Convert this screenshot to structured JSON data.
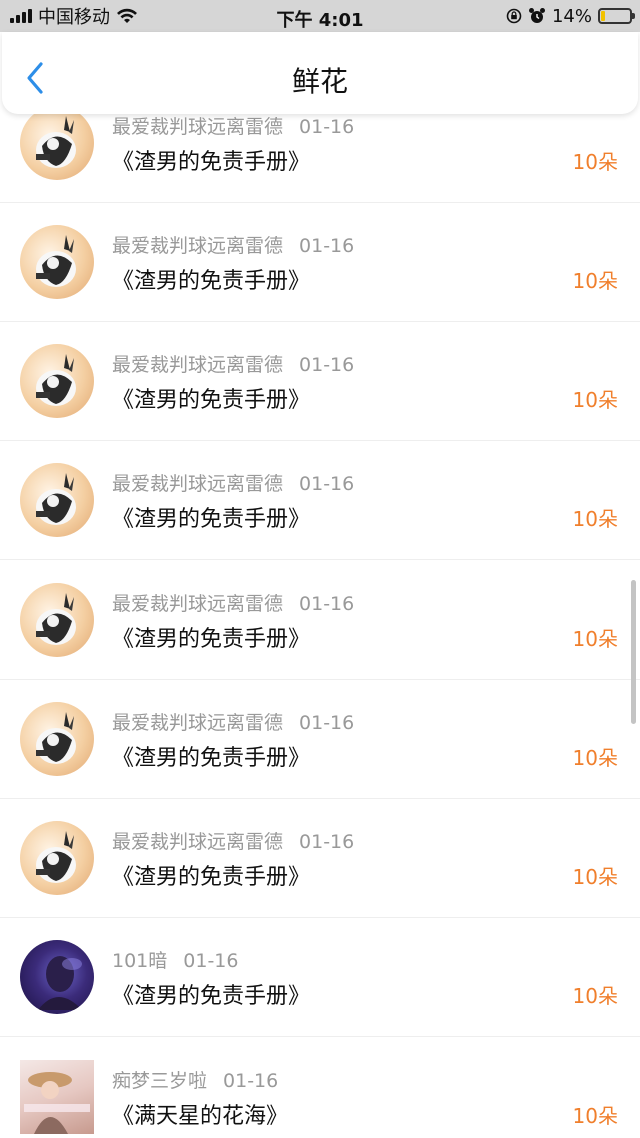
{
  "status_bar": {
    "carrier": "中国移动",
    "time": "下午 4:01",
    "battery": "14%",
    "battery_level": 0.14,
    "icons": [
      "signal-icon",
      "wifi-icon",
      "lock-rotation-icon",
      "alarm-icon",
      "battery-icon"
    ]
  },
  "nav": {
    "title": "鲜花",
    "back_icon": "chevron-left-icon"
  },
  "colors": {
    "accent": "#f07f2c",
    "back": "#2d8ee8",
    "meta": "#999999"
  },
  "items": [
    {
      "user": "最爱裁判球远离雷德",
      "date": "01-16",
      "title": "《渣男的免责手册》",
      "count": "10朵"
    },
    {
      "user": "最爱裁判球远离雷德",
      "date": "01-16",
      "title": "《渣男的免责手册》",
      "count": "10朵"
    },
    {
      "user": "最爱裁判球远离雷德",
      "date": "01-16",
      "title": "《渣男的免责手册》",
      "count": "10朵"
    },
    {
      "user": "最爱裁判球远离雷德",
      "date": "01-16",
      "title": "《渣男的免责手册》",
      "count": "10朵"
    },
    {
      "user": "最爱裁判球远离雷德",
      "date": "01-16",
      "title": "《渣男的免责手册》",
      "count": "10朵"
    },
    {
      "user": "最爱裁判球远离雷德",
      "date": "01-16",
      "title": "《渣男的免责手册》",
      "count": "10朵"
    },
    {
      "user": "最爱裁判球远离雷德",
      "date": "01-16",
      "title": "《渣男的免责手册》",
      "count": "10朵"
    },
    {
      "user": "101暗",
      "date": "01-16",
      "title": "《渣男的免责手册》",
      "count": "10朵"
    },
    {
      "user": "痴梦三岁啦",
      "date": "01-16",
      "title": "《满天星的花海》",
      "count": "10朵"
    }
  ]
}
